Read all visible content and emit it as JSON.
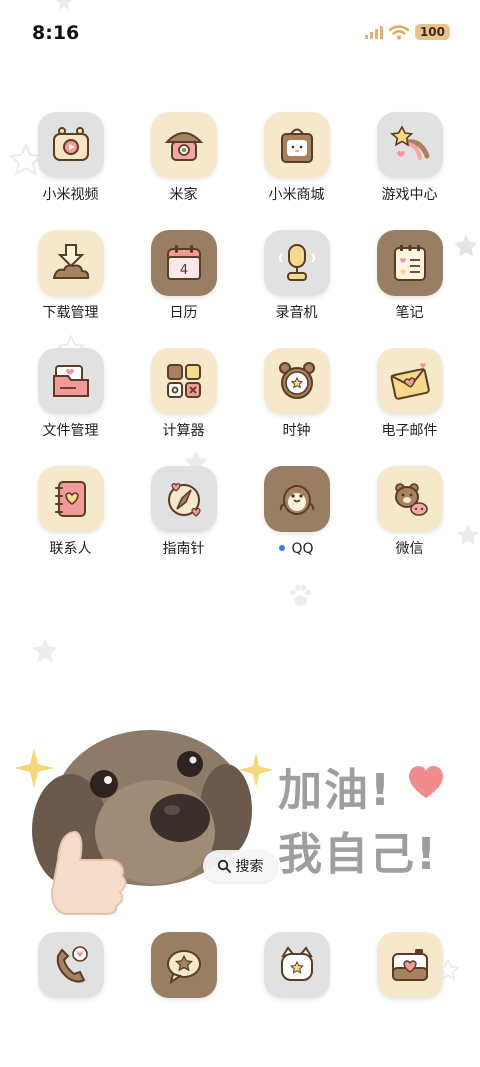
{
  "status_bar": {
    "time": "8:16",
    "battery": "100"
  },
  "apps": [
    {
      "label": "小米视频",
      "icon": "video-camera-icon",
      "tile": "gray"
    },
    {
      "label": "米家",
      "icon": "mushroom-house-icon",
      "tile": "cream"
    },
    {
      "label": "小米商城",
      "icon": "shopping-bag-icon",
      "tile": "cream"
    },
    {
      "label": "游戏中心",
      "icon": "shooting-star-icon",
      "tile": "gray"
    },
    {
      "label": "下载管理",
      "icon": "download-arrow-icon",
      "tile": "cream"
    },
    {
      "label": "日历",
      "icon": "calendar-icon",
      "tile": "brown"
    },
    {
      "label": "录音机",
      "icon": "microphone-icon",
      "tile": "gray"
    },
    {
      "label": "笔记",
      "icon": "notepad-icon",
      "tile": "brown"
    },
    {
      "label": "文件管理",
      "icon": "folder-icon",
      "tile": "gray"
    },
    {
      "label": "计算器",
      "icon": "calculator-icon",
      "tile": "cream"
    },
    {
      "label": "时钟",
      "icon": "alarm-clock-icon",
      "tile": "cream"
    },
    {
      "label": "电子邮件",
      "icon": "envelope-heart-icon",
      "tile": "cream"
    },
    {
      "label": "联系人",
      "icon": "contact-book-icon",
      "tile": "cream"
    },
    {
      "label": "指南针",
      "icon": "compass-icon",
      "tile": "gray"
    },
    {
      "label": "QQ",
      "icon": "penguin-icon",
      "tile": "brown"
    },
    {
      "label": "微信",
      "icon": "bear-chat-icon",
      "tile": "cream"
    }
  ],
  "calendar_day": "4",
  "widget": {
    "search_label": "搜索",
    "motto_line1": "加油!",
    "motto_line2": "我自己!"
  },
  "dock": [
    {
      "icon": "phone-icon",
      "tile": "gray"
    },
    {
      "icon": "message-icon",
      "tile": "brown"
    },
    {
      "icon": "browser-icon",
      "tile": "gray"
    },
    {
      "icon": "camera-icon",
      "tile": "cream"
    }
  ],
  "colors": {
    "tile_gray": "#e2e1e1",
    "tile_cream": "#f6e8cb",
    "tile_brown": "#9a7e63",
    "accent_dot": "#3b7cf0",
    "heart": "#f07a7a"
  }
}
